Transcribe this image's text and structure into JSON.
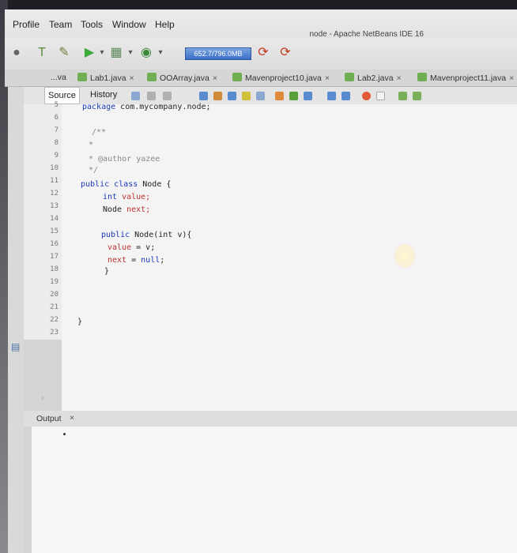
{
  "menubar": {
    "items": [
      "Profile",
      "Team",
      "Tools",
      "Window",
      "Help"
    ],
    "window_title": "node - Apache NetBeans IDE 16"
  },
  "toolbar": {
    "memory_meter": "652.7/796.0MB"
  },
  "tabs": [
    {
      "label": "...va"
    },
    {
      "label": "Lab1.java",
      "close": "×"
    },
    {
      "label": "OOArray.java",
      "close": "×"
    },
    {
      "label": "Mavenproject10.java",
      "close": "×"
    },
    {
      "label": "Lab2.java",
      "close": "×"
    },
    {
      "label": "Mavenproject11.java",
      "close": "×"
    }
  ],
  "editor_tabs": {
    "source": "Source",
    "history": "History"
  },
  "gutter": {
    "lines": [
      "5",
      "6",
      "7",
      "8",
      "9",
      "10",
      "11",
      "12",
      "13",
      "14",
      "15",
      "16",
      "17",
      "18",
      "19",
      "20",
      "21",
      "22",
      "23"
    ]
  },
  "code": {
    "l5_kw": "package",
    "l5_rest": " com.mycompany.node;",
    "l7": "/**",
    "l8": "*",
    "l9": "* @author yazee",
    "l10": "*/",
    "l11_kw": "public class",
    "l11_rest": " Node {",
    "l12_kw": "int",
    "l12_fld": " value;",
    "l13_type": "Node",
    "l13_fld": " next;",
    "l15_kw": "public",
    "l15_rest": " Node(int v){",
    "l16_fld": "value",
    "l16_rest": " = v;",
    "l17_fld": "next",
    "l17_mid": " = ",
    "l17_kw": "null",
    "l17_rest": ";",
    "l18": "}",
    "l22": "}"
  },
  "output": {
    "label": "Output",
    "close": "×"
  }
}
